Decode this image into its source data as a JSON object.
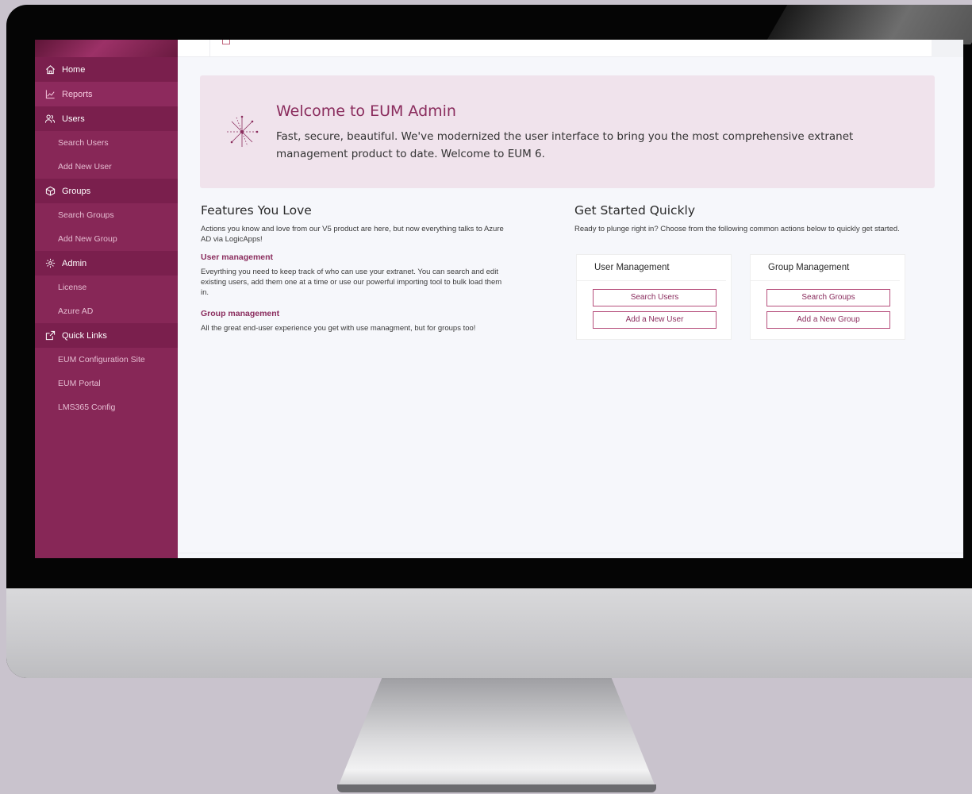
{
  "sidebar": {
    "sections": [
      {
        "label": "Home",
        "icon": "home-icon"
      },
      {
        "label": "Reports",
        "icon": "chart-line-icon"
      },
      {
        "label": "Users",
        "icon": "users-icon",
        "items": [
          "Search Users",
          "Add New User"
        ]
      },
      {
        "label": "Groups",
        "icon": "cube-icon",
        "items": [
          "Search Groups",
          "Add New Group"
        ]
      },
      {
        "label": "Admin",
        "icon": "gear-icon",
        "items": [
          "License",
          "Azure AD"
        ]
      },
      {
        "label": "Quick Links",
        "icon": "external-link-icon",
        "items": [
          "EUM Configuration Site",
          "EUM Portal",
          "LMS365 Config"
        ]
      }
    ]
  },
  "welcome": {
    "title": "Welcome to EUM Admin",
    "text": "Fast, secure, beautiful. We've modernized the user interface to bring you the most comprehensive extranet management product to date. Welcome to EUM 6."
  },
  "features": {
    "title": "Features You Love",
    "intro": "Actions you know and love from our V5 product are here, but now everything talks to Azure AD via LogicApps!",
    "user_title": "User management",
    "user_text": "Eveyrthing you need to keep track of who can use your extranet. You can search and edit existing users, add them one at a time or use our powerful importing tool to bulk load them in.",
    "group_title": "Group management",
    "group_text": "All the great end-user experience you get with use managment, but for groups too!"
  },
  "quick": {
    "title": "Get Started Quickly",
    "intro": "Ready to plunge right in? Choose from the following common actions below to quickly get started.",
    "user_card": {
      "title": "User Management",
      "btn1": "Search Users",
      "btn2": "Add a New User"
    },
    "group_card": {
      "title": "Group Management",
      "btn1": "Search Groups",
      "btn2": "Add a New Group"
    }
  },
  "colors": {
    "brand": "#872757",
    "accent": "#8a2c5d",
    "banner": "#f0e3ec"
  }
}
